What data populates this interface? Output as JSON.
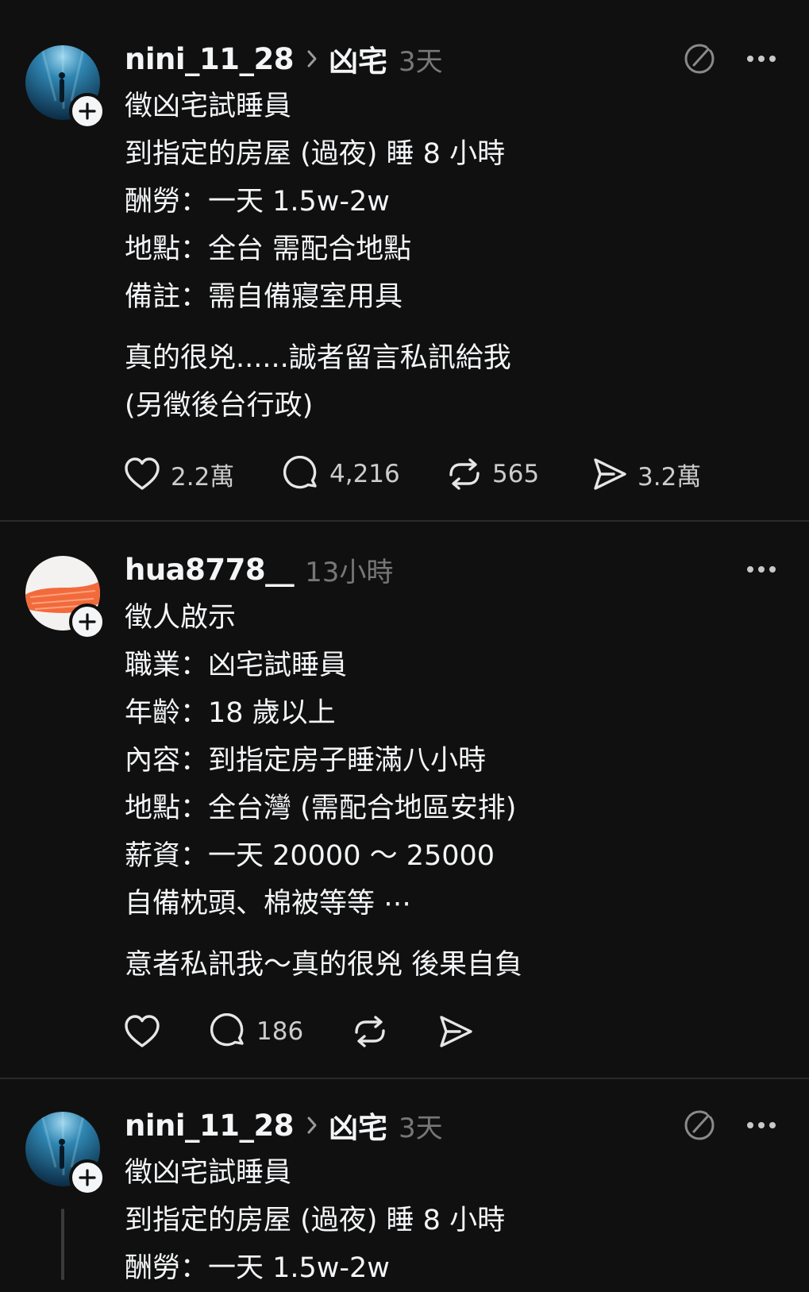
{
  "posts": [
    {
      "username": "nini_11_28",
      "topic": "凶宅",
      "time": "3天",
      "lines": [
        "徵凶宅試睡員",
        "到指定的房屋 (過夜) 睡 8 小時",
        "酬勞：一天 1.5w-2w",
        "地點：全台 需配合地點",
        "備註：需自備寢室用具"
      ],
      "lines2": [
        "真的很兇......誠者留言私訊給我",
        "(另徵後台行政)"
      ],
      "likes": "2.2萬",
      "comments": "4,216",
      "reposts": "565",
      "shares": "3.2萬"
    },
    {
      "username": "hua8778__",
      "time": "13小時",
      "lines": [
        "徵人啟示",
        "職業：凶宅試睡員",
        "年齡：18 歲以上",
        "內容：到指定房子睡滿八小時",
        "地點：全台灣 (需配合地區安排)",
        "薪資：一天 20000 ～ 25000",
        "自備枕頭、棉被等等 ⋯"
      ],
      "lines2": [
        "意者私訊我～真的很兇 後果自負"
      ],
      "comments": "186"
    },
    {
      "username": "nini_11_28",
      "topic": "凶宅",
      "time": "3天",
      "lines": [
        "徵凶宅試睡員",
        "到指定的房屋 (過夜) 睡 8 小時",
        "酬勞：一天 1.5w-2w"
      ]
    }
  ],
  "colors": {
    "background": "#101010",
    "text": "#f3f5f7",
    "muted": "#777777",
    "divider": "#2a2a2a"
  },
  "icons": [
    "heart-icon",
    "comment-icon",
    "repost-icon",
    "share-icon",
    "more-icon",
    "topic-chevron-icon",
    "follow-plus-icon"
  ]
}
